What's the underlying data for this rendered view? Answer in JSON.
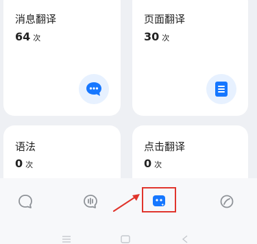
{
  "cards": [
    {
      "title": "消息翻译",
      "count": "64",
      "unit": "次",
      "icon": "chat-bubble-icon"
    },
    {
      "title": "页面翻译",
      "count": "30",
      "unit": "次",
      "icon": "document-icon"
    },
    {
      "title": "语法",
      "count": "0",
      "unit": "次"
    },
    {
      "title": "点击翻译",
      "count": "0",
      "unit": "次"
    }
  ],
  "bottom_nav": [
    {
      "name": "chat",
      "icon": "chat-bubble-outline-icon",
      "active": false
    },
    {
      "name": "voice",
      "icon": "voice-wave-icon",
      "active": false
    },
    {
      "name": "tools",
      "icon": "robot-face-icon",
      "active": true
    },
    {
      "name": "discover",
      "icon": "compass-leaf-icon",
      "active": false
    }
  ],
  "colors": {
    "accent": "#1677ff",
    "icon_bg": "#e7f1ff",
    "highlight": "#e0342b",
    "nav_inactive": "#8e9297"
  },
  "system_nav": [
    "menu-icon",
    "home-icon",
    "back-icon"
  ]
}
